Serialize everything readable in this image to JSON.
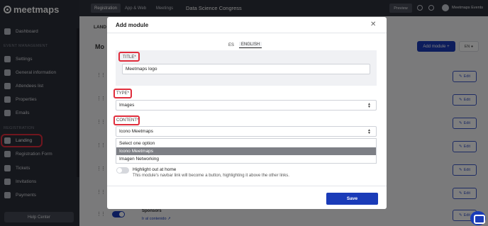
{
  "sidebar": {
    "logo": "meetmaps",
    "section_event": "EVENT MANAGEMENT",
    "section_registration": "REGISTRATION",
    "items": [
      {
        "label": "Dashboard",
        "icon": "dashboard-icon"
      },
      {
        "label": "Settings",
        "icon": "gear-icon"
      },
      {
        "label": "General information",
        "icon": "info-icon"
      },
      {
        "label": "Attendees list",
        "icon": "list-icon"
      },
      {
        "label": "Properties",
        "icon": "list-icon"
      },
      {
        "label": "Emails",
        "icon": "mail-icon"
      },
      {
        "label": "Landing",
        "icon": "globe-icon"
      },
      {
        "label": "Registration Form",
        "icon": "form-icon"
      },
      {
        "label": "Tickets",
        "icon": "ticket-icon"
      },
      {
        "label": "Invitations",
        "icon": "invite-icon"
      },
      {
        "label": "Payments",
        "icon": "card-icon"
      }
    ],
    "help": "Help Center"
  },
  "topbar": {
    "tabs": [
      "Registration",
      "App & Web",
      "Meetings"
    ],
    "event_name": "Data Science Congress",
    "preview": "Preview",
    "user": "Meetmaps Events"
  },
  "page": {
    "tab_label": "LAND",
    "title": "Mo",
    "add_module": "Add module",
    "language": "EN",
    "edit_label": "Edit",
    "sponsors_title": "Sponsors",
    "sponsors_link": "Ir al contenido"
  },
  "modal": {
    "title": "Add module",
    "lang_tabs": [
      "ES",
      "ENGLISH"
    ],
    "title_label": "TITLE*",
    "title_value": "Meetmaps logo",
    "type_label": "TYPE*",
    "type_value": "Images",
    "content_label": "CONTENT*",
    "content_value": "Icono Meetmaps",
    "options": [
      "Select one option",
      "Icono Meetmaps",
      "Imagen Networking"
    ],
    "selected_option_index": 1,
    "highlight_title": "Highlight out at home",
    "highlight_desc": "This module's navbar link will become a button, highlighting it above the other links.",
    "save": "Save"
  },
  "colors": {
    "primary": "#1a3bb8",
    "highlight": "#e02d3c",
    "sidebar_bg": "#2b2e38"
  }
}
